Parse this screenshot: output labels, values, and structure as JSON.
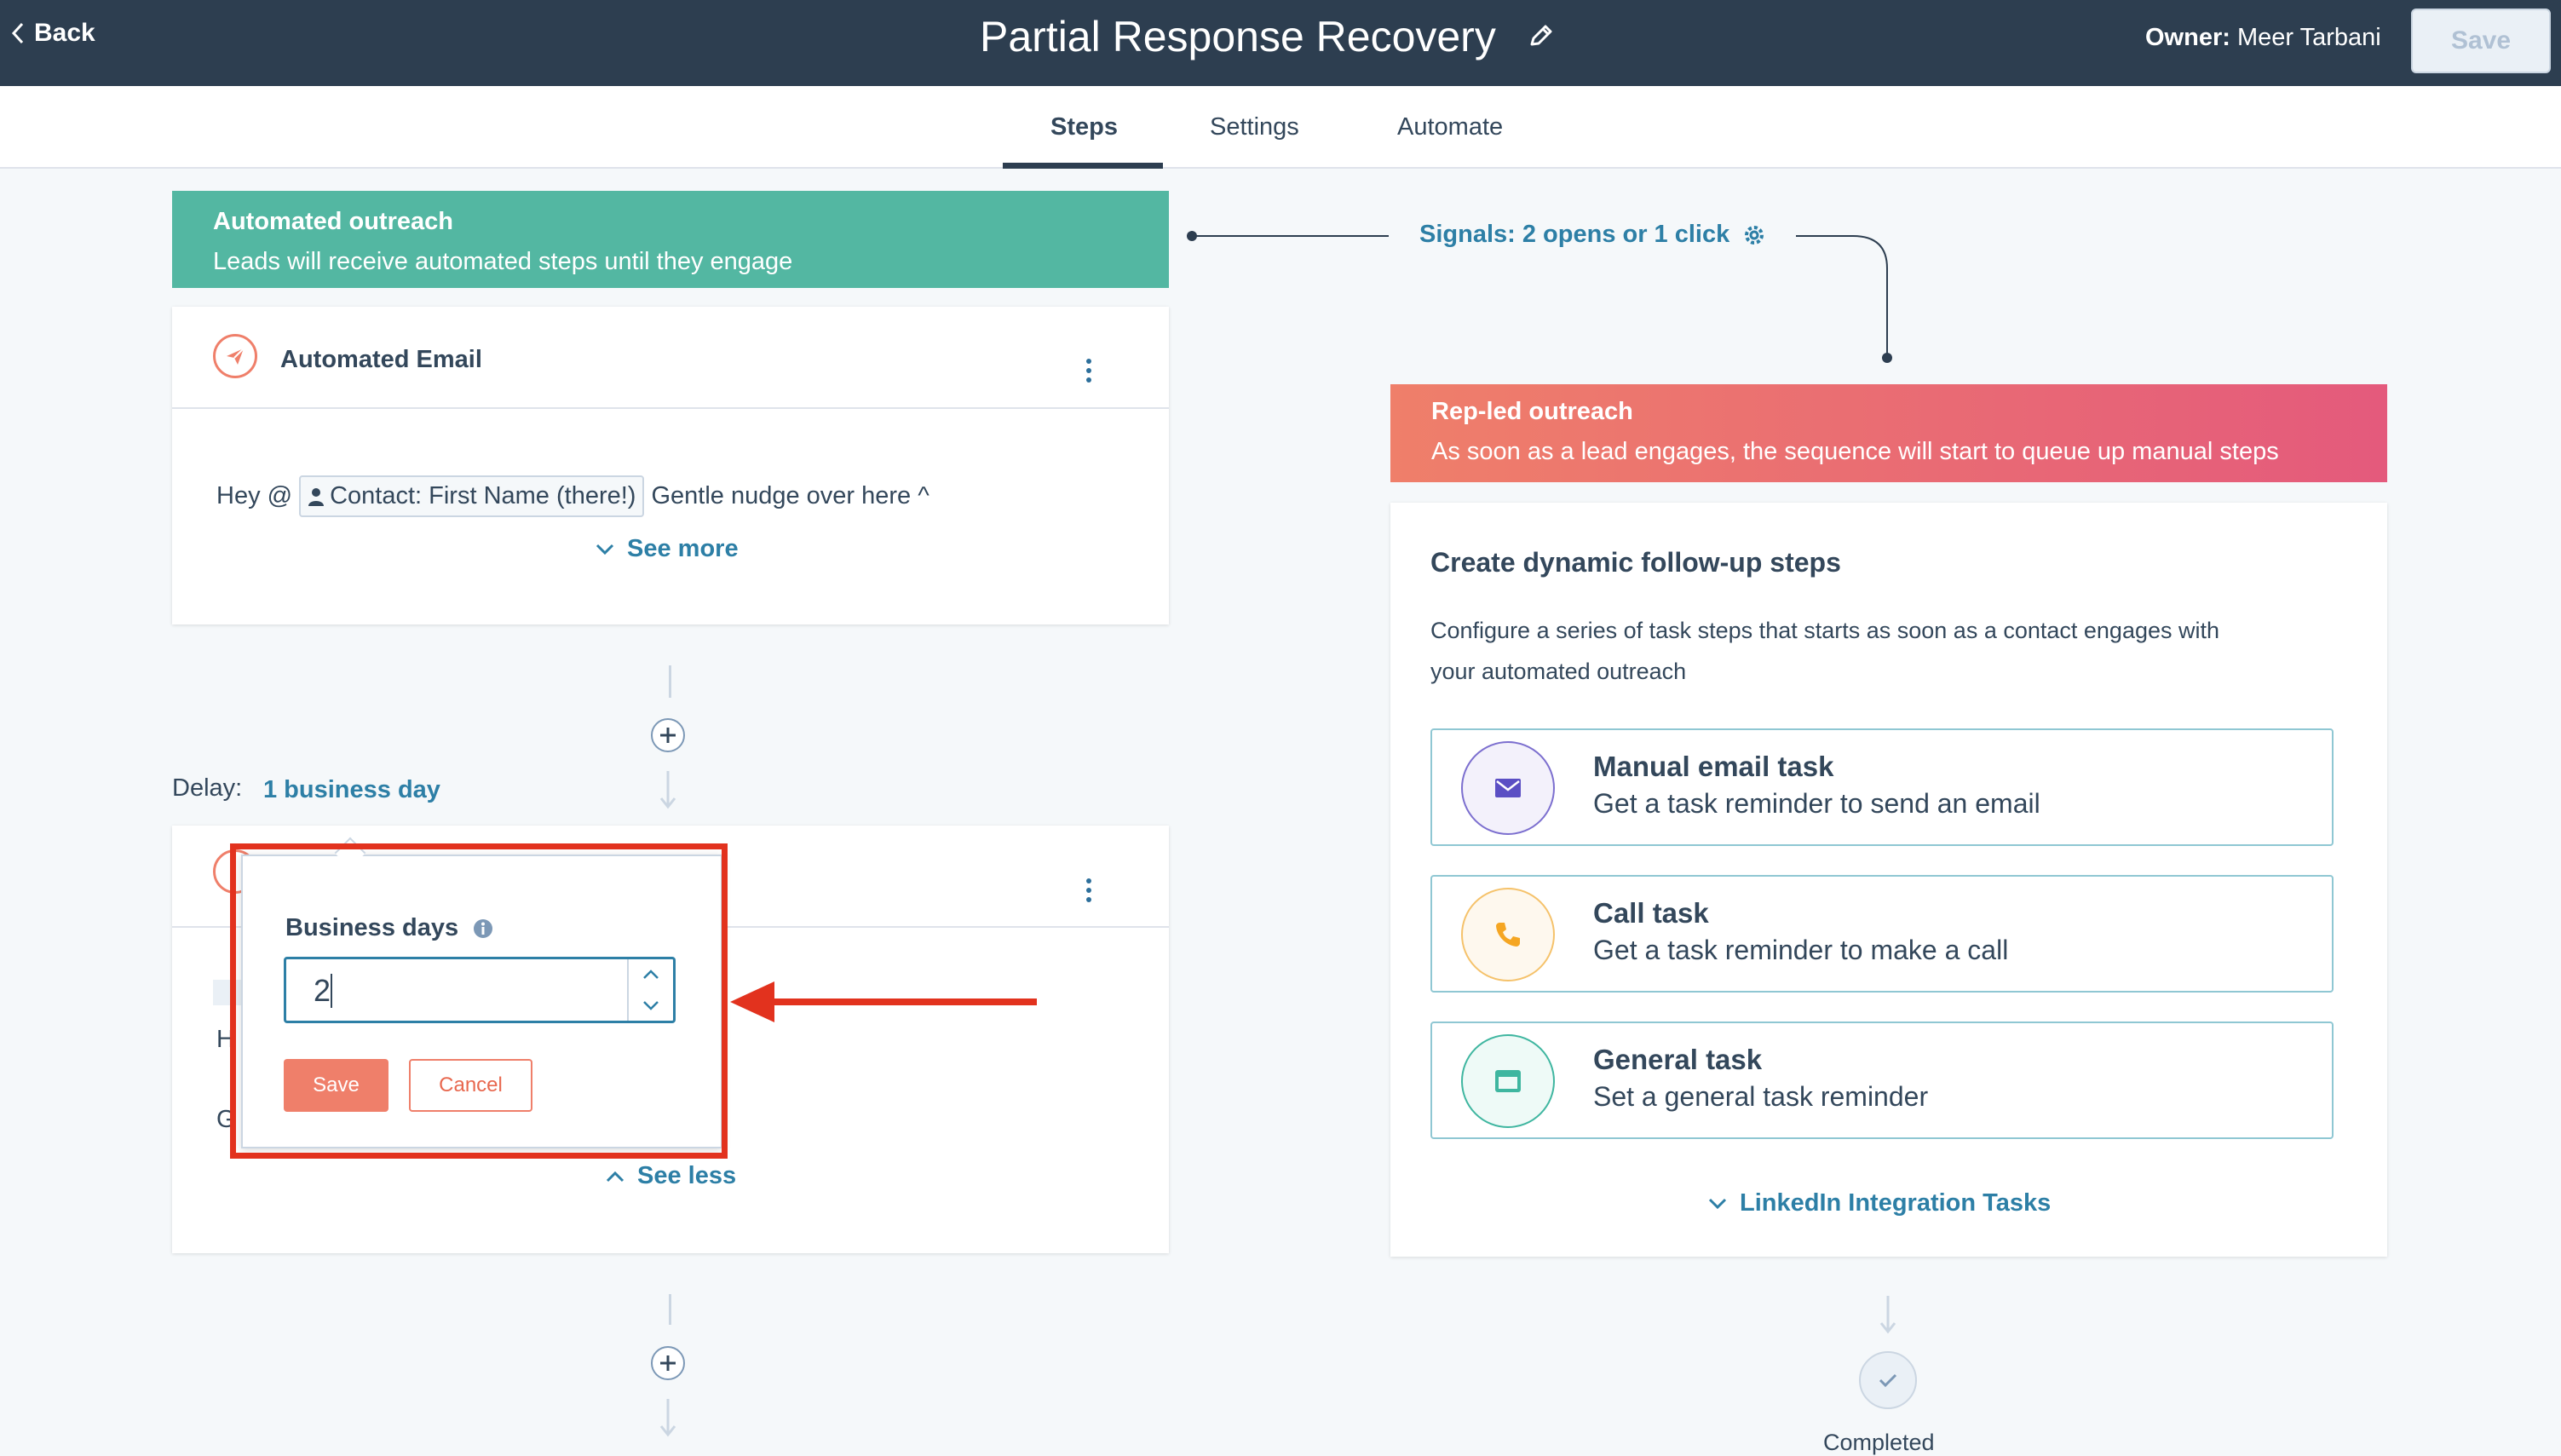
{
  "header": {
    "back_label": "Back",
    "title": "Partial Response Recovery",
    "owner_label": "Owner:",
    "owner_name": "Meer Tarbani",
    "save_label": "Save"
  },
  "tabs": [
    {
      "label": "Steps",
      "active": true
    },
    {
      "label": "Settings",
      "active": false
    },
    {
      "label": "Automate",
      "active": false
    }
  ],
  "automated": {
    "banner_title": "Automated outreach",
    "banner_desc": "Leads will receive automated steps until they engage",
    "email_card_title": "Automated Email",
    "email_body_prefix": "Hey @",
    "token_label": "Contact: First Name (there!)",
    "email_body_suffix": "Gentle nudge over here ^",
    "see_more": "See more",
    "delay_label": "Delay:",
    "delay_value": "1 business day",
    "second_card_partial_1": "H",
    "second_card_partial_2": "G",
    "see_less": "See less"
  },
  "signals": {
    "label": "Signals: 2 opens or 1 click"
  },
  "rep_led": {
    "banner_title": "Rep-led outreach",
    "banner_desc": "As soon as a lead engages, the sequence will start to queue up manual steps",
    "card_title": "Create dynamic follow-up steps",
    "card_desc_line1": "Configure a series of task steps that starts as soon as a contact engages with",
    "card_desc_line2": "your automated outreach",
    "tasks": [
      {
        "title": "Manual email task",
        "desc": "Get a task reminder to send an email",
        "icon": "envelope-icon",
        "color": "#7c6fcf"
      },
      {
        "title": "Call task",
        "desc": "Get a task reminder to make a call",
        "icon": "phone-icon",
        "color": "#f5a623"
      },
      {
        "title": "General task",
        "desc": "Set a general task reminder",
        "icon": "window-icon",
        "color": "#3fb6a0"
      }
    ],
    "linkedin_label": "LinkedIn Integration Tasks",
    "completed_label": "Completed"
  },
  "popover": {
    "field_label": "Business days",
    "value": "2",
    "save_label": "Save",
    "cancel_label": "Cancel"
  },
  "colors": {
    "topbar": "#2d3e50",
    "teal_banner": "#53b7a2",
    "pink_banner_start": "#ef7f6a",
    "pink_banner_end": "#e45a7c",
    "link": "#2d7fa6",
    "annotation_red": "#e2321e"
  }
}
